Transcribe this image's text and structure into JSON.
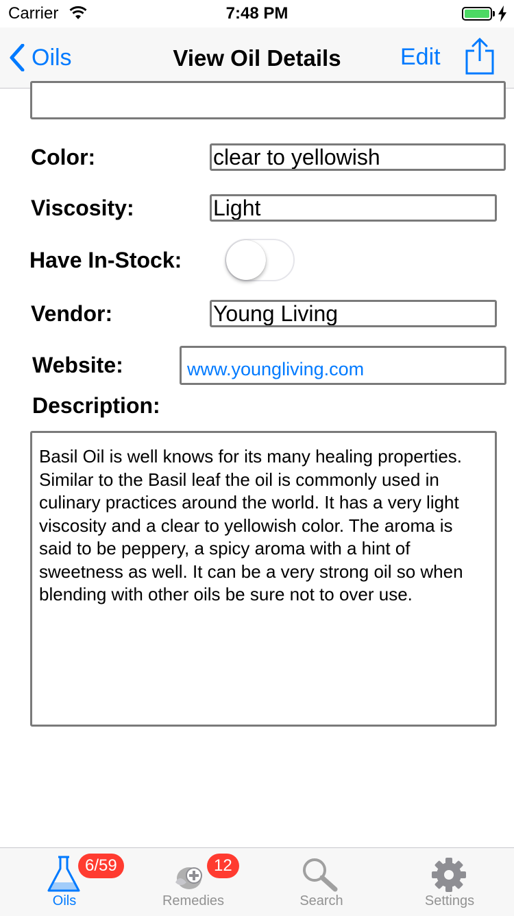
{
  "status_bar": {
    "carrier": "Carrier",
    "time": "7:48 PM"
  },
  "nav": {
    "back_label": "Oils",
    "title": "View Oil Details",
    "edit_label": "Edit"
  },
  "form": {
    "color_label": "Color:",
    "color_value": "clear to yellowish",
    "viscosity_label": "Viscosity:",
    "viscosity_value": "Light",
    "in_stock_label": "Have In-Stock:",
    "in_stock": false,
    "vendor_label": "Vendor:",
    "vendor_value": "Young Living",
    "website_label": "Website:",
    "website_value": "www.youngliving.com",
    "description_label": "Description:",
    "description_value": "Basil Oil is well knows for its many healing properties.  Similar to the Basil leaf the oil is commonly used in culinary practices around the world.  It has a very light viscosity and a clear to yellowish color.  The aroma is said to be peppery, a spicy aroma with a hint of sweetness as well.  It can be a very strong oil so when blending with other oils be sure not to over use."
  },
  "tabs": [
    {
      "label": "Oils",
      "icon": "flask-icon",
      "badge": "6/59",
      "active": true
    },
    {
      "label": "Remedies",
      "icon": "remedies-icon",
      "badge": "12",
      "active": false
    },
    {
      "label": "Search",
      "icon": "search-icon",
      "badge": "",
      "active": false
    },
    {
      "label": "Settings",
      "icon": "gear-icon",
      "badge": "",
      "active": false
    }
  ],
  "colors": {
    "accent": "#007aff",
    "badge": "#ff3b30",
    "battery": "#4cd964",
    "field_border": "#7a7a7a"
  }
}
